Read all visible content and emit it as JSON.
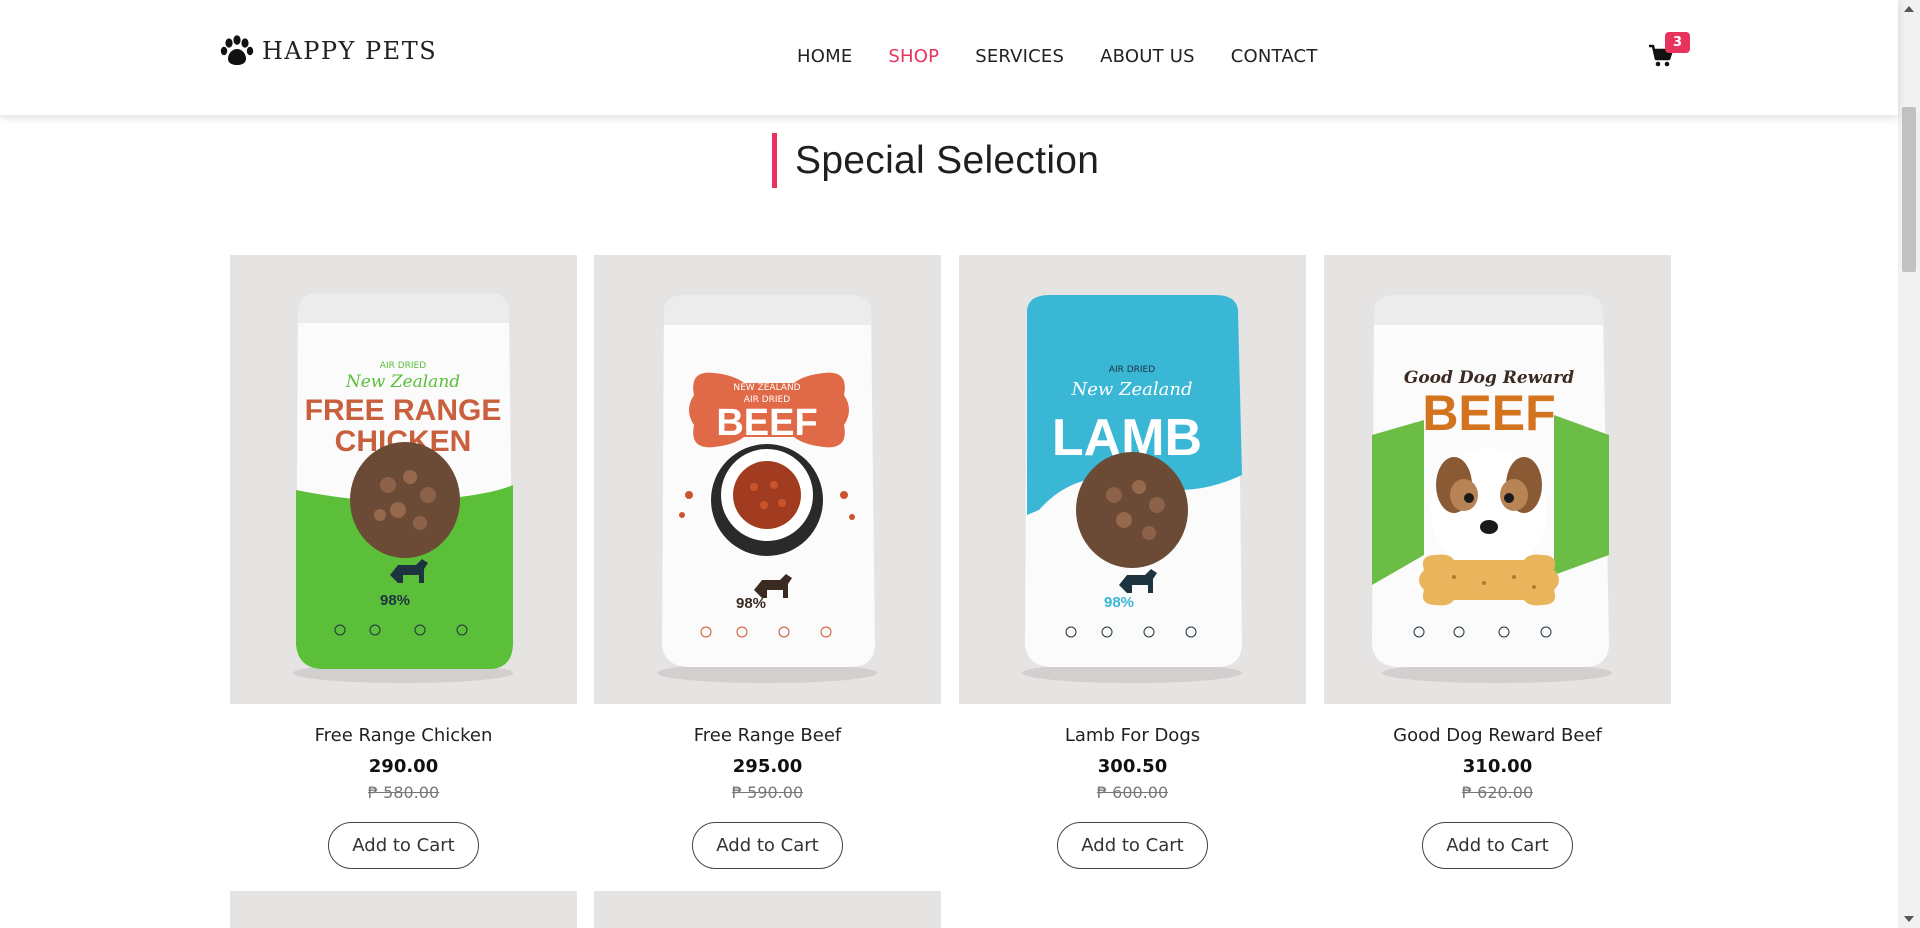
{
  "brand": {
    "name": "HAPPY PETS",
    "icon": "paw-icon"
  },
  "nav": [
    {
      "label": "HOME",
      "active": false
    },
    {
      "label": "SHOP",
      "active": true
    },
    {
      "label": "SERVICES",
      "active": false
    },
    {
      "label": "ABOUT US",
      "active": false
    },
    {
      "label": "CONTACT",
      "active": false
    }
  ],
  "cart": {
    "icon": "cart-icon",
    "count": "3"
  },
  "section": {
    "title": "Special Selection"
  },
  "products": [
    {
      "name": "Free Range Chicken",
      "price": "290.00",
      "old_price": "₱ 580.00",
      "button": "Add to Cart",
      "package": {
        "top": "AIR DRIED",
        "script": "New Zealand",
        "big": "FREE RANGE",
        "big2": "CHICKEN",
        "percent": "98%",
        "accent": "#5cbf3a",
        "text_color": "#c8603d"
      }
    },
    {
      "name": "Free Range Beef",
      "price": "295.00",
      "old_price": "₱ 590.00",
      "button": "Add to Cart",
      "package": {
        "top": "NEW ZEALAND",
        "script": "AIR DRIED",
        "big": "BEEF",
        "big2": "",
        "percent": "98%",
        "accent": "#e06a47",
        "text_color": "#ffffff"
      }
    },
    {
      "name": "Lamb For Dogs",
      "price": "300.50",
      "old_price": "₱ 600.00",
      "button": "Add to Cart",
      "package": {
        "top": "AIR DRIED",
        "script": "New Zealand",
        "big": "LAMB",
        "big2": "",
        "percent": "98%",
        "accent": "#3bb7d6",
        "text_color": "#ffffff"
      }
    },
    {
      "name": "Good Dog Reward Beef",
      "price": "310.00",
      "old_price": "₱ 620.00",
      "button": "Add to Cart",
      "package": {
        "top": "",
        "script": "Good Dog Reward",
        "big": "BEEF",
        "big2": "",
        "percent": "",
        "accent": "#6cbd45",
        "text_color": "#d4731e"
      }
    }
  ],
  "colors": {
    "accent": "#e8335e",
    "card_bg": "#e6e3e3"
  }
}
